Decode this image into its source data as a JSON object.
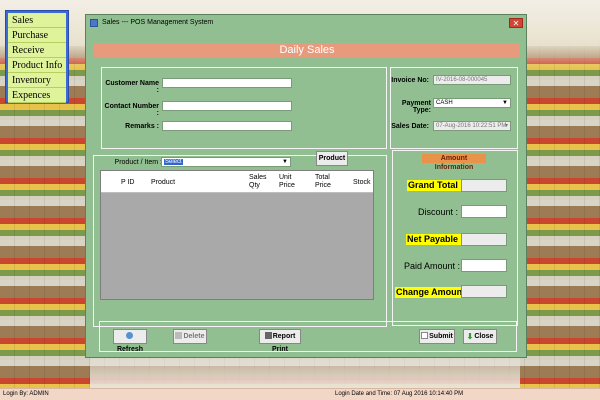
{
  "menu": {
    "items": [
      "Sales",
      "Purchase",
      "Receive",
      "Product Info",
      "Inventory",
      "Expences"
    ]
  },
  "window": {
    "title": "Sales --- POS Management System",
    "close_glyph": "✕"
  },
  "banner": "Daily Sales",
  "customer": {
    "name_label": "Customer Name :",
    "contact_label": "Contact Number :",
    "remarks_label": "Remarks :"
  },
  "invoice": {
    "invoice_label": "Invoice No:",
    "invoice_value": "IV-2016-08-000045",
    "payment_label": "Payment Type:",
    "payment_value": "CASH",
    "date_label": "Sales Date:",
    "date_value": "07-Aug-2016 10:22:51 PM"
  },
  "product_selector": {
    "label": "Product / Item :",
    "value": "Select",
    "button": "Product"
  },
  "grid": {
    "headers": [
      "P ID",
      "Product",
      "Sales Qty",
      "Unit Price",
      "Total Price",
      "Stock"
    ]
  },
  "amount": {
    "title": "Amount Information",
    "grand_total": "Grand Total :",
    "discount": "Discount :",
    "net_payable": "Net Payable :",
    "paid_amount": "Paid Amount :",
    "change_amount": "Change Amount:"
  },
  "actions": {
    "refresh": "Refresh",
    "delete": "Delete",
    "report_print": "Report Print",
    "submit": "Submit",
    "close": "Close"
  },
  "status": {
    "login_by": "Login By:  ADMIN",
    "login_datetime": "Login Date and Time:  07 Aug 2016 10:14:40 PM"
  },
  "colors": {
    "window_bg": "#92bf91",
    "banner": "#e89a7c",
    "menu_item_bg": "#dff39a",
    "highlight": "#ffff00",
    "amount_title": "#e9924a"
  }
}
